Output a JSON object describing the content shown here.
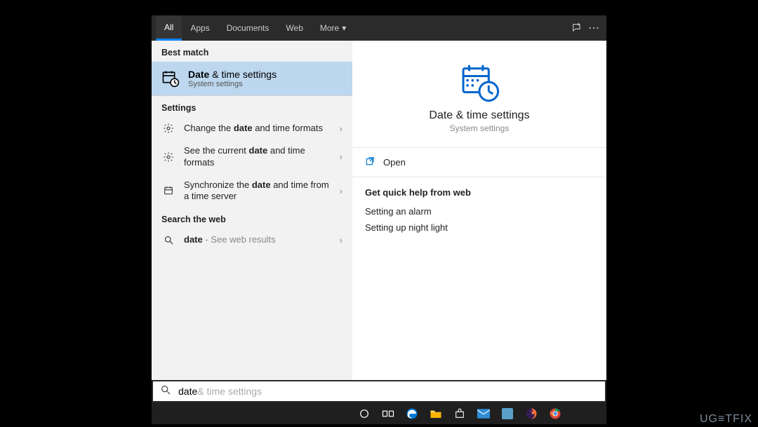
{
  "tabs": {
    "all": "All",
    "apps": "Apps",
    "documents": "Documents",
    "web": "Web",
    "more": "More"
  },
  "left": {
    "best_match_header": "Best match",
    "best_match": {
      "title_bold": "Date",
      "title_rest": " & time settings",
      "subtitle": "System settings"
    },
    "settings_header": "Settings",
    "settings": [
      {
        "pre": "Change the ",
        "bold": "date",
        "post": " and time formats"
      },
      {
        "pre": "See the current ",
        "bold": "date",
        "post": " and time formats"
      },
      {
        "pre": "Synchronize the ",
        "bold": "date",
        "post": " and time from a time server"
      }
    ],
    "search_web_header": "Search the web",
    "web_result": {
      "bold": "date",
      "suffix": " - See web results"
    }
  },
  "right": {
    "title": "Date & time settings",
    "subtitle": "System settings",
    "actions": {
      "open": "Open"
    },
    "help_header": "Get quick help from web",
    "help_links": [
      "Setting an alarm",
      "Setting up night light"
    ]
  },
  "search": {
    "typed": "date",
    "hint": " & time settings"
  },
  "watermark": "UG≡TFIX"
}
